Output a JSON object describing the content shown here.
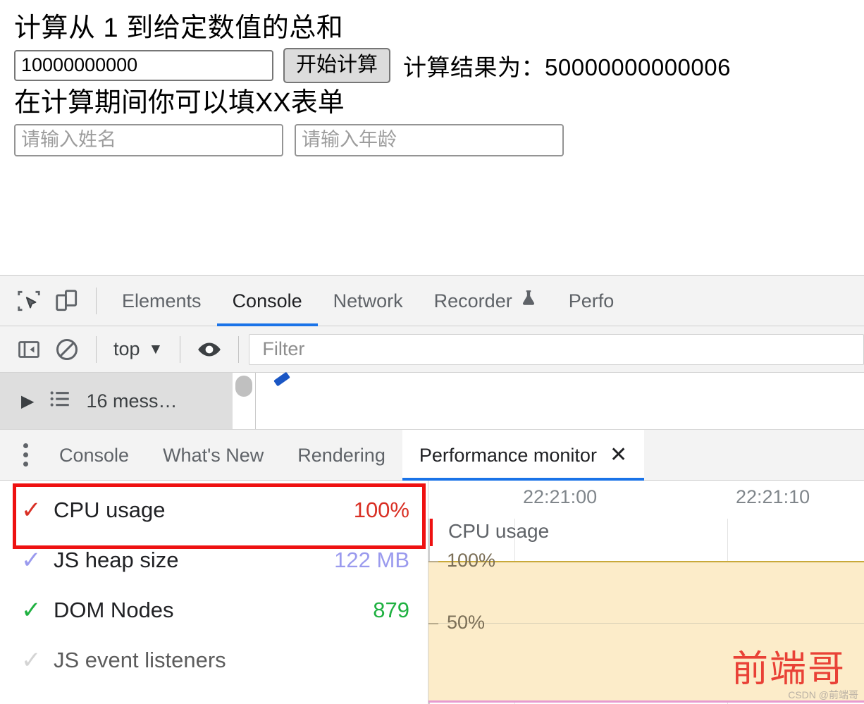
{
  "page": {
    "heading": "计算从 1 到给定数值的总和",
    "calc_input_value": "10000000000",
    "calc_button_label": "开始计算",
    "result_text": "计算结果为：50000000000006",
    "form_heading": "在计算期间你可以填XX表单",
    "name_placeholder": "请输入姓名",
    "age_placeholder": "请输入年龄"
  },
  "devtools": {
    "icons": {
      "inspect": "inspect-element-icon",
      "device": "device-toolbar-icon",
      "sidebar": "show-console-sidebar-icon",
      "clear": "clear-console-icon",
      "eye": "live-expression-icon"
    },
    "tabs": [
      {
        "label": "Elements",
        "active": false
      },
      {
        "label": "Console",
        "active": true
      },
      {
        "label": "Network",
        "active": false
      },
      {
        "label": "Recorder",
        "active": false,
        "badge": "flask-icon"
      },
      {
        "label": "Perfo",
        "active": false
      }
    ],
    "console_toolbar": {
      "context_label": "top",
      "context_caret": "▼",
      "filter_placeholder": "Filter"
    },
    "messages_bar": {
      "expand_caret": "▶",
      "list_icon": "list-icon",
      "summary": "16 mess…"
    },
    "drawer_tabs": [
      {
        "label": "Console",
        "active": false
      },
      {
        "label": "What's New",
        "active": false
      },
      {
        "label": "Rendering",
        "active": false
      },
      {
        "label": "Performance monitor",
        "active": true,
        "close": "✕"
      }
    ],
    "metrics": [
      {
        "label": "CPU usage",
        "value": "100%",
        "checked": true,
        "color": "#d93025",
        "check_color": "#d93025",
        "highlighted": true
      },
      {
        "label": "JS heap size",
        "value": "122 MB",
        "checked": true,
        "color": "#9a9aee",
        "check_color": "#9a9aee",
        "highlighted": false
      },
      {
        "label": "DOM Nodes",
        "value": "879",
        "checked": true,
        "color": "#1fb141",
        "check_color": "#1fb141",
        "highlighted": false
      },
      {
        "label": "JS event listeners",
        "value": "",
        "checked": false,
        "color": "#5c5c5c",
        "check_color": "#d0d0d0",
        "highlighted": false
      }
    ]
  },
  "chart_data": {
    "type": "area",
    "title": "CPU usage",
    "series": [
      {
        "name": "CPU usage",
        "values": [
          100,
          100,
          100,
          100,
          100,
          100,
          100,
          100,
          100,
          100
        ],
        "color": "#c8a93a",
        "fill": "#fcecc9"
      }
    ],
    "x": [
      "22:21:00",
      "22:21:10"
    ],
    "xlabel": "",
    "ylabel": "",
    "ytick_labels": [
      "100%",
      "50%"
    ],
    "ylim": [
      0,
      110
    ],
    "grid": true,
    "legend": "none",
    "annotations": [
      "前端哥"
    ]
  },
  "watermark": {
    "text": "前端哥",
    "sub": "CSDN @前端哥"
  }
}
